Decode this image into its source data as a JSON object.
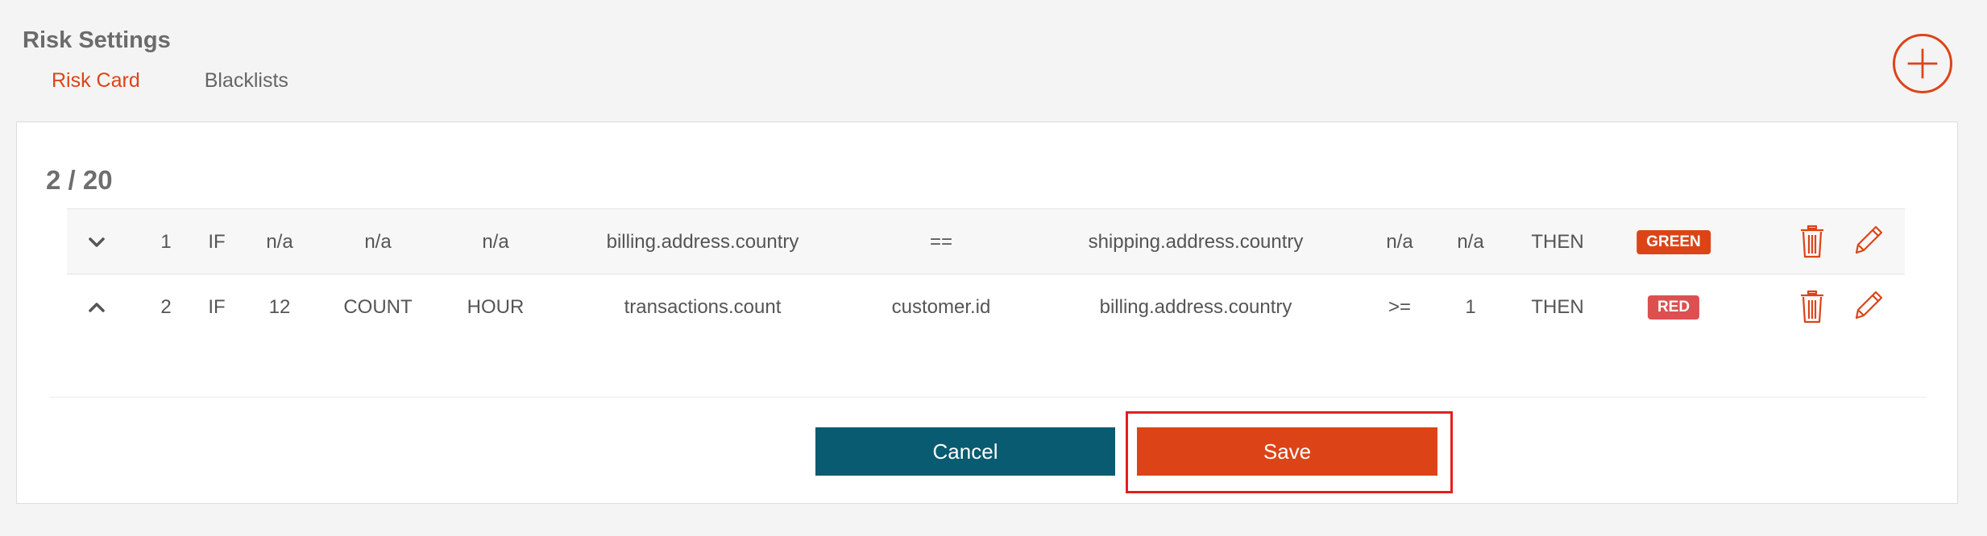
{
  "header": {
    "title": "Risk Settings",
    "tabs": [
      {
        "label": "Risk Card",
        "active": true
      },
      {
        "label": "Blacklists",
        "active": false
      }
    ]
  },
  "card": {
    "count": "2 / 20",
    "rules": [
      {
        "chevron": "chevron-down-icon",
        "index": "1",
        "if": "IF",
        "threshold": "n/a",
        "function": "n/a",
        "period": "n/a",
        "field": "billing.address.country",
        "group_by": "==",
        "compare_field": "shipping.address.country",
        "operator": "n/a",
        "value": "n/a",
        "then": "THEN",
        "result": "GREEN"
      },
      {
        "chevron": "chevron-up-icon",
        "index": "2",
        "if": "IF",
        "threshold": "12",
        "function": "COUNT",
        "period": "HOUR",
        "field": "transactions.count",
        "group_by": "customer.id",
        "compare_field": "billing.address.country",
        "operator": ">=",
        "value": "1",
        "then": "THEN",
        "result": "RED"
      }
    ]
  },
  "actions": {
    "cancel_label": "Cancel",
    "save_label": "Save"
  },
  "colors": {
    "accent": "#dc4418",
    "cancel": "#085b70",
    "red_badge": "#dc5050",
    "highlight": "#e02020"
  }
}
